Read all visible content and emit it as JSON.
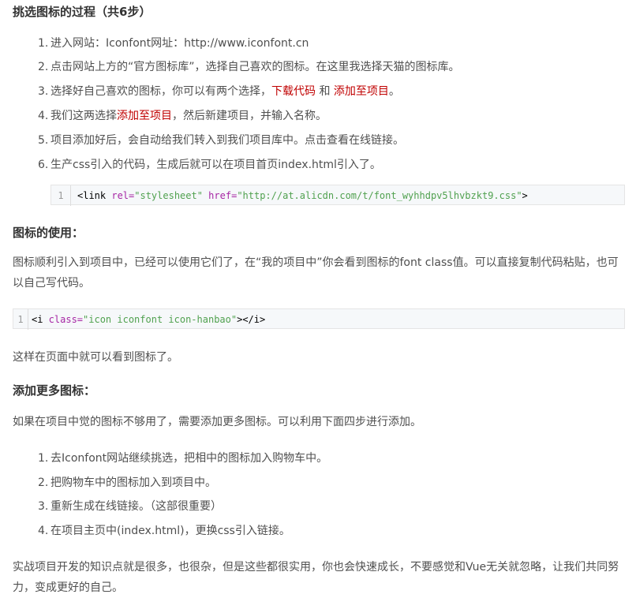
{
  "section1": {
    "heading": "挑选图标的过程（共6步）",
    "steps": [
      {
        "num": "1.",
        "text": "进入网站：Iconfont网址：http://www.iconfont.cn"
      },
      {
        "num": "2.",
        "text": "点击网站上方的“官方图标库”，选择自己喜欢的图标。在这里我选择天猫的图标库。"
      },
      {
        "num": "3.",
        "text_before": "选择好自己喜欢的图标，你可以有两个选择，",
        "red1": "下载代码",
        "mid": " 和 ",
        "red2": "添加至项目",
        "text_after": "。"
      },
      {
        "num": "4.",
        "text_before": "我们这两选择",
        "red": "添加至项目",
        "text_after": "，然后新建项目，并输入名称。"
      },
      {
        "num": "5.",
        "text": "项目添加好后，会自动给我们转入到我们项目库中。点击查看在线链接。"
      },
      {
        "num": "6.",
        "text": "生产css引入的代码，生成后就可以在项目首页index.html引入了。"
      }
    ],
    "code": {
      "line": "1",
      "tag_open": "<link",
      "attr1": " rel=",
      "val1": "\"stylesheet\"",
      "attr2": " href=",
      "val2": "\"http://at.alicdn.com/t/font_wyhhdpv5lhvbzkt9.css\"",
      "tag_close": ">"
    }
  },
  "section2": {
    "heading": "图标的使用：",
    "para": "图标顺利引入到项目中，已经可以使用它们了，在“我的项目中”你会看到图标的font class值。可以直接复制代码粘贴，也可以自己写代码。",
    "code": {
      "line": "1",
      "tag_open": "<i",
      "attr1": " class=",
      "val1": "\"icon iconfont icon-hanbao\"",
      "tag_close": "></i>"
    },
    "after": "这样在页面中就可以看到图标了。"
  },
  "section3": {
    "heading": "添加更多图标：",
    "para": "如果在项目中觉的图标不够用了，需要添加更多图标。可以利用下面四步进行添加。",
    "steps": [
      {
        "num": "1.",
        "text": "去Iconfont网站继续挑选，把相中的图标加入购物车中。"
      },
      {
        "num": "2.",
        "text": "把购物车中的图标加入到项目中。"
      },
      {
        "num": "3.",
        "text": "重新生成在线链接。（这部很重要）"
      },
      {
        "num": "4.",
        "text": "在项目主页中(index.html)，更换css引入链接。"
      }
    ],
    "closing": "实战项目开发的知识点就是很多，也很杂，但是这些都很实用，你也会快速成长，不要感觉和Vue无关就忽略，让我们共同努力，变成更好的自己。"
  }
}
